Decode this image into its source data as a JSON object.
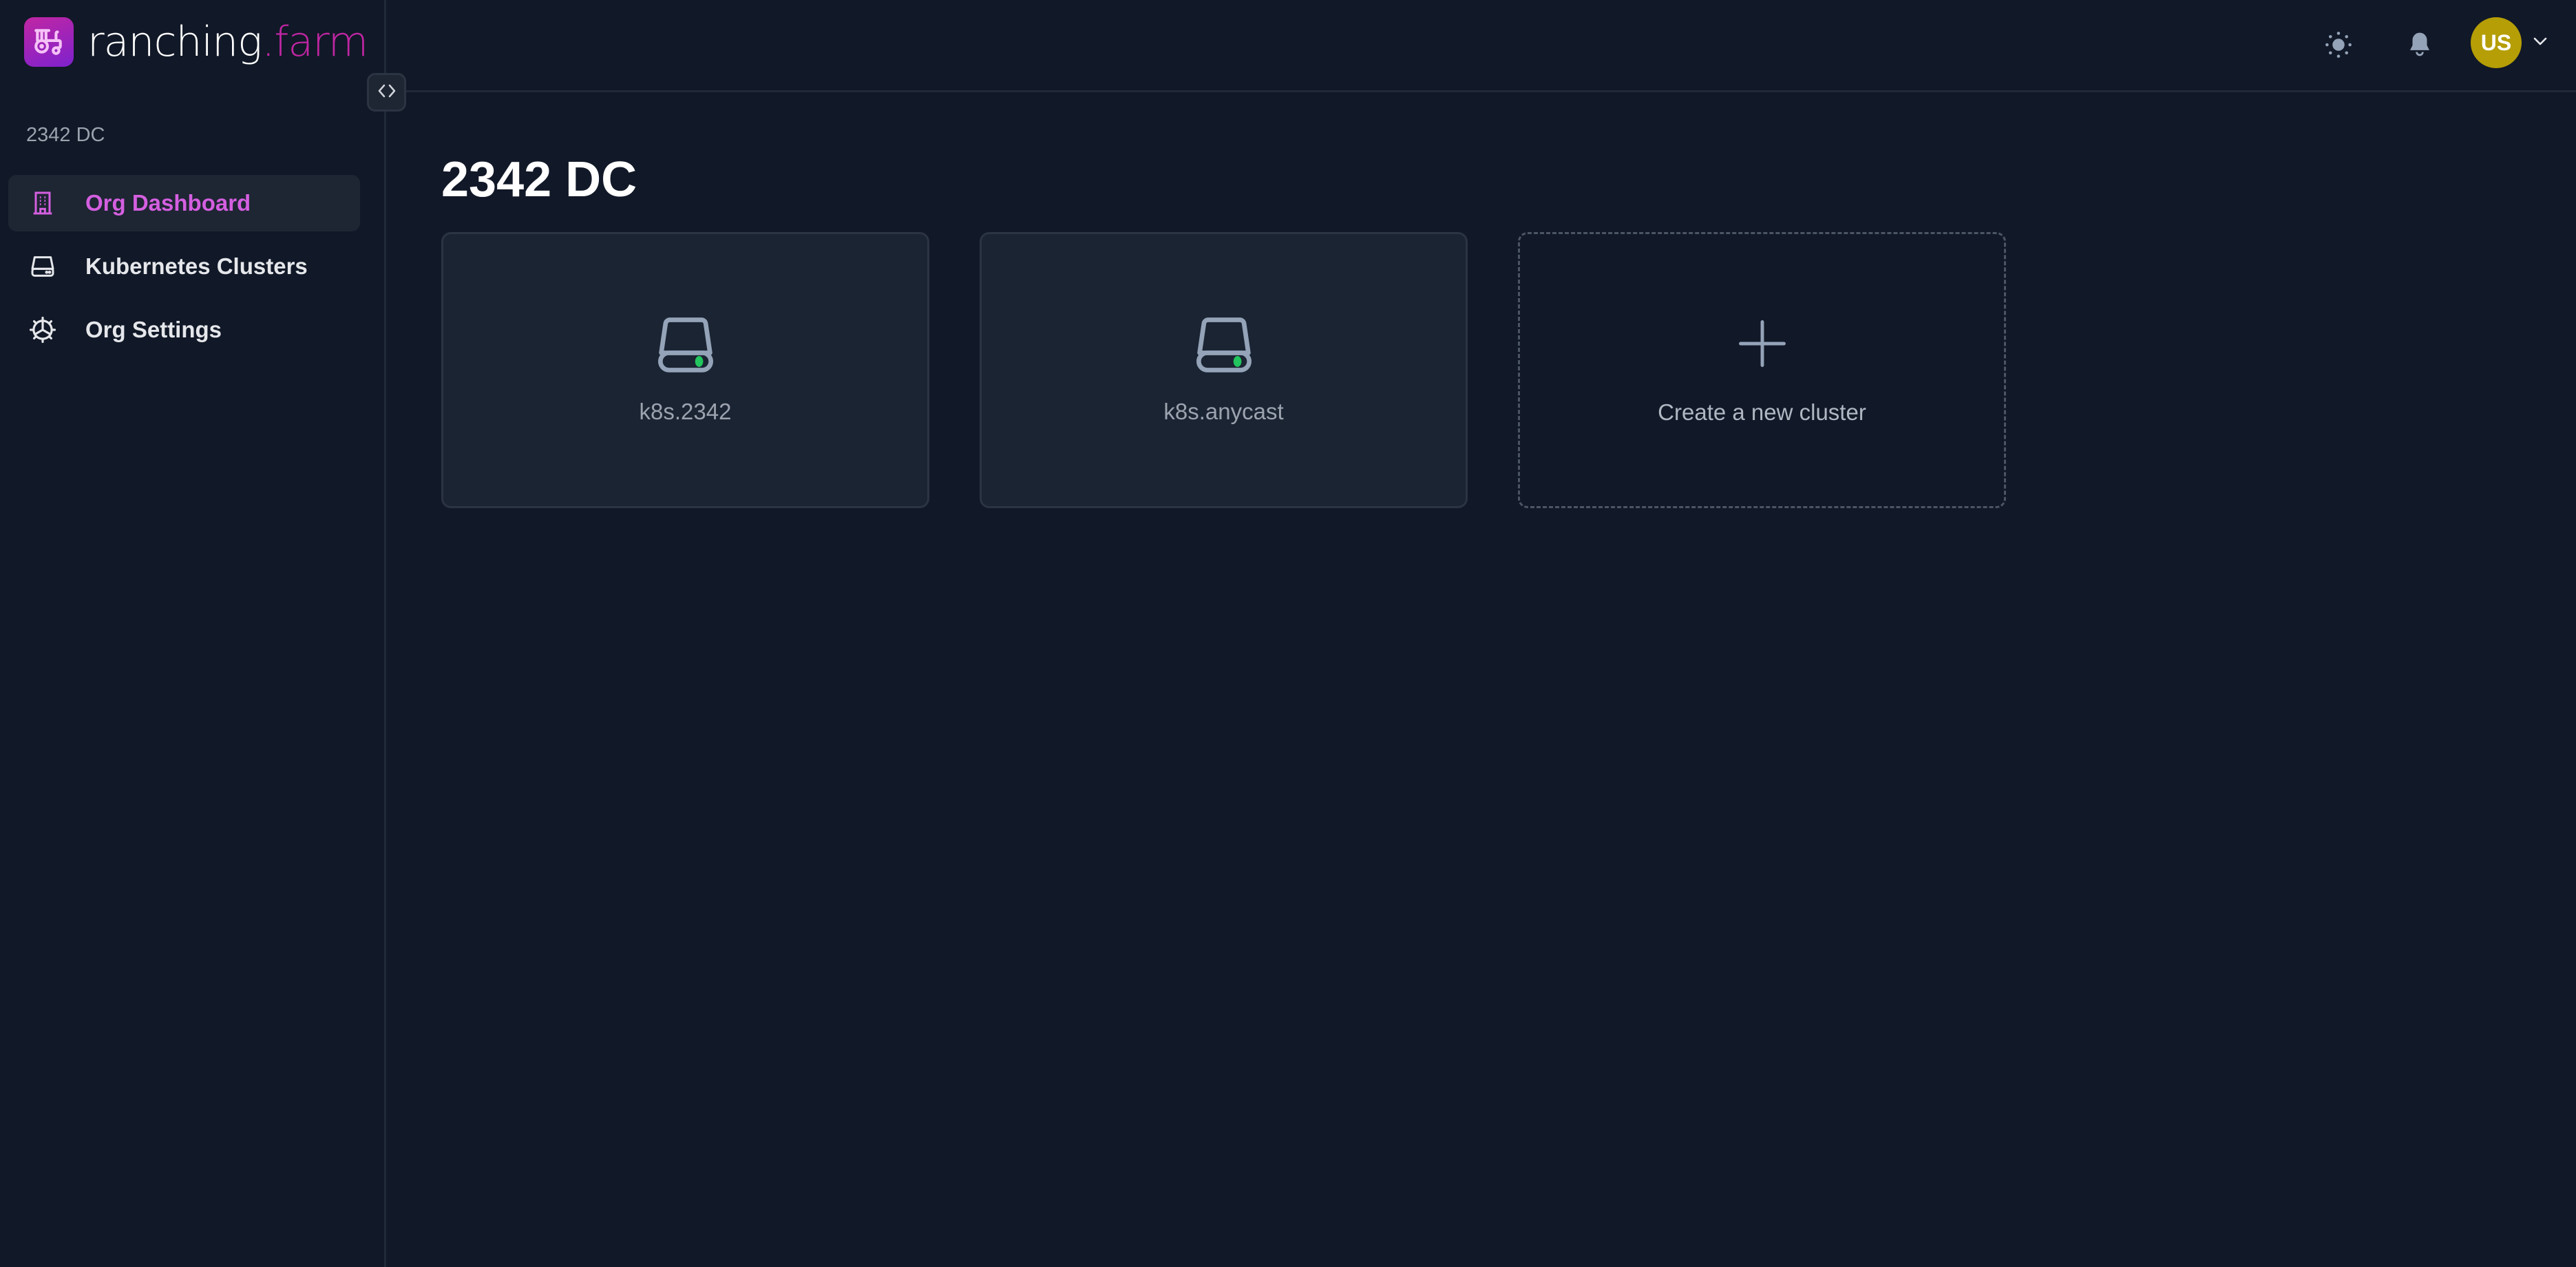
{
  "brand": {
    "name": "ranching",
    "tld": ".farm",
    "accent": "#c026a3"
  },
  "sidebar": {
    "org_label": "2342 DC",
    "items": [
      {
        "label": "Org Dashboard",
        "icon": "building-icon",
        "active": true
      },
      {
        "label": "Kubernetes Clusters",
        "icon": "server-icon",
        "active": false
      },
      {
        "label": "Org Settings",
        "icon": "cog-icon",
        "active": false
      }
    ]
  },
  "header": {
    "theme_toggle_icon": "sun-icon",
    "notifications_icon": "bell-icon",
    "user_initials": "US",
    "avatar_color": "#b59e06"
  },
  "main": {
    "title": "2342 DC",
    "clusters": [
      {
        "name": "k8s.2342",
        "status": "online",
        "status_color": "#22c55e"
      },
      {
        "name": "k8s.anycast",
        "status": "online",
        "status_color": "#22c55e"
      }
    ],
    "create_label": "Create a new cluster"
  }
}
